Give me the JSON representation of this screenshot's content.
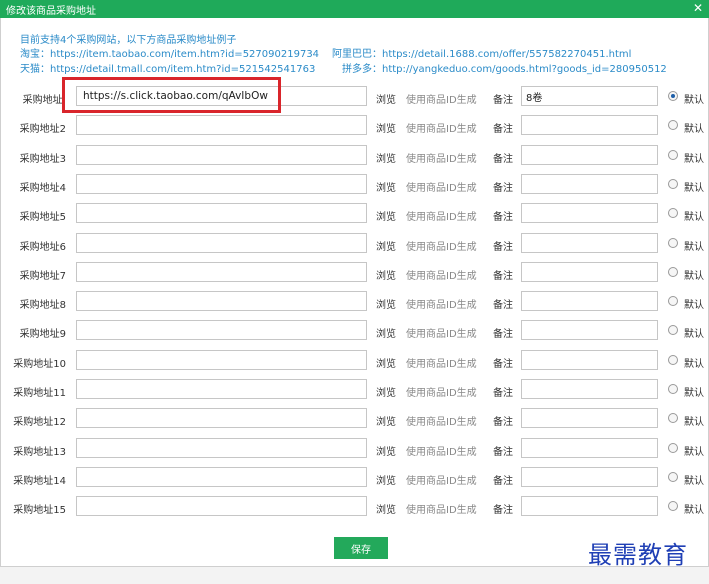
{
  "dialog": {
    "title": "修改该商品采购地址",
    "close_icon": "close-icon"
  },
  "info": {
    "line1": "目前支持4个采购网站，以下方商品采购地址例子",
    "taobao": "淘宝：https://item.taobao.com/item.htm?id=527090219734",
    "alibaba": "阿里巴巴：https://detail.1688.com/offer/557582270451.html",
    "tmall": "天猫：https://detail.tmall.com/item.htm?id=521542541763",
    "pinduoduo": "拼多多：http://yangkeduo.com/goods.html?goods_id=280950512"
  },
  "common": {
    "browse": "浏览",
    "generate": "使用商品ID生成",
    "note_label": "备注",
    "default": "默认"
  },
  "rows": [
    {
      "label": "采购地址:",
      "url": "https://s.click.taobao.com/qAvIbOw",
      "note": "8卷",
      "default": true
    },
    {
      "label": "采购地址2",
      "url": "",
      "note": "",
      "default": false
    },
    {
      "label": "采购地址3",
      "url": "",
      "note": "",
      "default": false
    },
    {
      "label": "采购地址4",
      "url": "",
      "note": "",
      "default": false
    },
    {
      "label": "采购地址5",
      "url": "",
      "note": "",
      "default": false
    },
    {
      "label": "采购地址6",
      "url": "",
      "note": "",
      "default": false
    },
    {
      "label": "采购地址7",
      "url": "",
      "note": "",
      "default": false
    },
    {
      "label": "采购地址8",
      "url": "",
      "note": "",
      "default": false
    },
    {
      "label": "采购地址9",
      "url": "",
      "note": "",
      "default": false
    },
    {
      "label": "采购地址10",
      "url": "",
      "note": "",
      "default": false
    },
    {
      "label": "采购地址11",
      "url": "",
      "note": "",
      "default": false
    },
    {
      "label": "采购地址12",
      "url": "",
      "note": "",
      "default": false
    },
    {
      "label": "采购地址13",
      "url": "",
      "note": "",
      "default": false
    },
    {
      "label": "采购地址14",
      "url": "",
      "note": "",
      "default": false
    },
    {
      "label": "采购地址15",
      "url": "",
      "note": "",
      "default": false
    }
  ],
  "footer": {
    "save": "保存"
  },
  "watermark": "最需教育",
  "colors": {
    "titlebar": "#1faa5a",
    "link": "#2b8bc8",
    "highlight": "#d9252b",
    "save": "#23a95b"
  }
}
